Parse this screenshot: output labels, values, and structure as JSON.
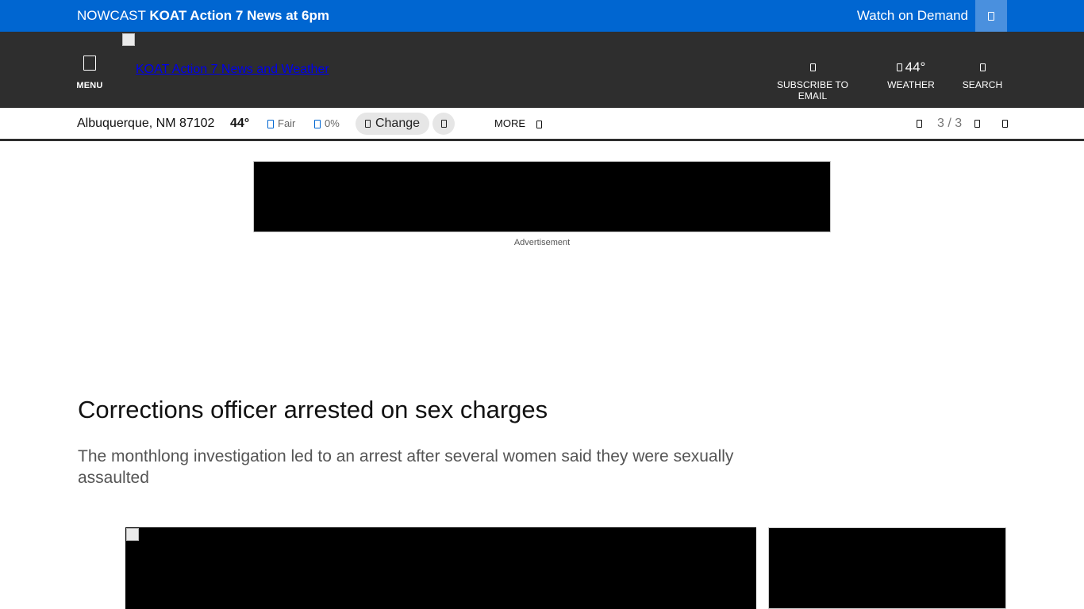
{
  "topbar": {
    "nowcast_prefix": "NOWCAST",
    "nowcast_title": "KOAT Action 7 News at 6pm",
    "watch_on_demand": "Watch on Demand",
    "color": "#0066d1"
  },
  "header": {
    "menu_label": "MENU",
    "logo_link_text": "KOAT Action 7 News and Weather",
    "subscribe_label": "SUBSCRIBE TO EMAIL",
    "weather_temp": "44°",
    "weather_label": "WEATHER",
    "search_label": "SEARCH",
    "color": "#2e2e2e"
  },
  "weather_bar": {
    "location": "Albuquerque, NM 87102",
    "temperature": "44°",
    "condition": "Fair",
    "precip": "0%",
    "change_label": "Change",
    "more_label": "MORE",
    "pager": "3 / 3"
  },
  "ad": {
    "label": "Advertisement"
  },
  "article": {
    "headline": "Corrections officer arrested on sex charges",
    "dek": "The monthlong investigation led to an arrest after several women said they were sexually assaulted"
  },
  "icons": {
    "menu": "menu-icon",
    "watch": "play-icon",
    "email": "envelope-icon",
    "weather": "cloud-icon",
    "search": "search-icon",
    "condition": "sun-icon",
    "precip": "raindrop-icon",
    "change": "location-pin-icon",
    "more": "chevron-down-icon"
  }
}
